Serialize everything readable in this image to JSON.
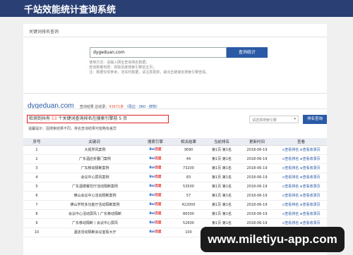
{
  "header": {
    "title": "千站效能统计查询系统"
  },
  "breadcrumb": "关键词排名查询",
  "query": {
    "domain": "dygeduan.com",
    "button": "查询统计"
  },
  "notes": [
    "使用方法：请输入网址查询排名数据；",
    "查询数量有限：抓取百度搜索引擎前五页；",
    "注：数据仅供参考，非实时数据，请注意更新，或点击链接去搜索引擎查看。"
  ],
  "result": {
    "domain": "dygeduan.com",
    "meta_label": "查询结果 总收录：",
    "total": "43671条",
    "links": "（周边 · 360 · 搜狗）"
  },
  "alert": {
    "pre": "检测到共有 ",
    "count": "53",
    "post": " 个关键词查询排名在搜索引擎前 5 页"
  },
  "tip": "温馨提示：因搜索结果不同，排名查询结果可能略有差异",
  "engine_select": "请选择搜索引擎",
  "sort_button": "排名查询",
  "table": {
    "headers": [
      "序号",
      "关键词",
      "搜索引擎",
      "相关结果",
      "当前排名",
      "更新时间",
      "查看"
    ],
    "engine": {
      "a": "Bai",
      "b": "百度"
    },
    "actions": {
      "ranking": "查看排名",
      "backlink": "查看收录页"
    },
    "rows": [
      {
        "idx": "1",
        "kw": "大视界风案例",
        "results": "3690",
        "rank": "第1页 第1名",
        "date": "2018-06-19"
      },
      {
        "idx": "2",
        "kw": "广东酒店折叠门案例",
        "results": "44",
        "rank": "第1页 第1名",
        "date": "2018-06-19"
      },
      {
        "idx": "3",
        "kw": "广东移动隔断案例",
        "results": "73200",
        "rank": "第1页 第1名",
        "date": "2018-06-19"
      },
      {
        "idx": "4",
        "kw": "会议中心屏风案例",
        "results": "83",
        "rank": "第1页 第1名",
        "date": "2018-06-19"
      },
      {
        "idx": "5",
        "kw": "广东酒楼餐饮厅活动隔断案例",
        "results": "53500",
        "rank": "第1页 第1名",
        "date": "2018-06-19"
      },
      {
        "idx": "6",
        "kw": "佛山会议中心活动隔断案例",
        "results": "57",
        "rank": "第1页 第1名",
        "date": "2018-06-19"
      },
      {
        "idx": "7",
        "kw": "佛山学校多功能厅活动隔断案例",
        "results": "422000",
        "rank": "第1页 第1名",
        "date": "2018-06-19"
      },
      {
        "idx": "8",
        "kw": "会议中心活动屏风丨广东移动隔断",
        "results": "86300",
        "rank": "第1页 第1名",
        "date": "2018-06-19"
      },
      {
        "idx": "9",
        "kw": "广东移动隔断丨会议中心屏风",
        "results": "52600",
        "rank": "第1页 第1名",
        "date": "2018-06-19"
      },
      {
        "idx": "10",
        "kw": "酒店活动隔断会议室看大厅",
        "results": "100",
        "rank": "第1页 第1名",
        "date": "2018-06-19"
      }
    ]
  },
  "watermark": "www.miletiyu-app.com"
}
